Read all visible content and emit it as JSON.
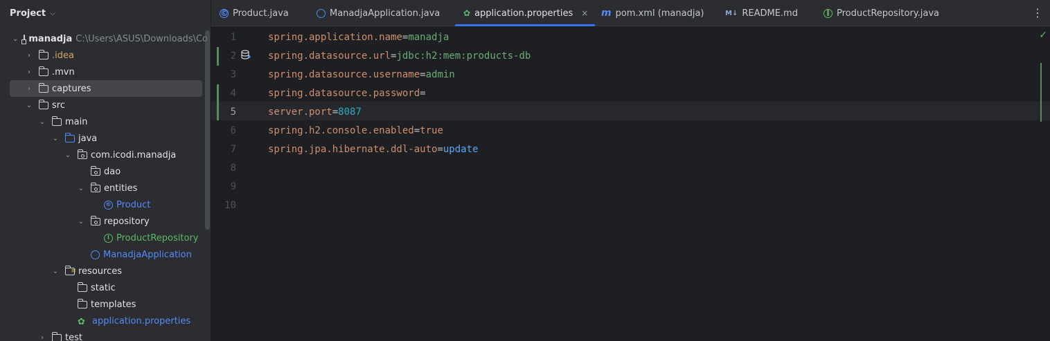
{
  "project_panel": {
    "title": "Project",
    "tree": [
      {
        "label": "manadja",
        "path": "C:\\Users\\ASUS\\Downloads\\Co"
      },
      {
        "label": ".idea"
      },
      {
        "label": ".mvn"
      },
      {
        "label": "captures"
      },
      {
        "label": "src"
      },
      {
        "label": "main"
      },
      {
        "label": "java"
      },
      {
        "label": "com.icodi.manadja"
      },
      {
        "label": "dao"
      },
      {
        "label": "entities"
      },
      {
        "label": "Product"
      },
      {
        "label": "repository"
      },
      {
        "label": "ProductRepository"
      },
      {
        "label": "ManadjaApplication"
      },
      {
        "label": "resources"
      },
      {
        "label": "static"
      },
      {
        "label": "templates"
      },
      {
        "label": "application.properties"
      },
      {
        "label": "test"
      }
    ]
  },
  "tabs": [
    {
      "label": "Product.java",
      "icon": "class-icon"
    },
    {
      "label": "ManadjaApplication.java",
      "icon": "spring-app-icon"
    },
    {
      "label": "application.properties",
      "icon": "spring-leaf-icon",
      "active": true
    },
    {
      "label": "pom.xml (manadja)",
      "icon": "maven-icon"
    },
    {
      "label": "README.md",
      "icon": "markdown-icon"
    },
    {
      "label": "ProductRepository.java",
      "icon": "interface-icon"
    }
  ],
  "tab_close_glyph": "×",
  "tab_icons": {
    "class": "©",
    "maven": "m",
    "markdown": "M↓",
    "interface": "I"
  },
  "editor": {
    "line_numbers": [
      "1",
      "2",
      "3",
      "4",
      "5",
      "6",
      "7",
      "8",
      "9",
      "10"
    ],
    "current_line": 5,
    "lines": [
      {
        "key": "spring.application.name",
        "eq": "=",
        "value": "manadja",
        "value_type": "string"
      },
      {
        "key": "spring.datasource.url",
        "eq": "=",
        "value": "jdbc:h2:mem:products-db",
        "value_type": "string"
      },
      {
        "key": "spring.datasource.username",
        "eq": "=",
        "value": "admin",
        "value_type": "string"
      },
      {
        "key": "spring.datasource.password",
        "eq": "=",
        "value": "",
        "value_type": "string"
      },
      {
        "key": "server.port",
        "eq": "=",
        "value": "8087",
        "value_type": "number"
      },
      {
        "key": "spring.h2.console.enabled",
        "eq": "=",
        "value": "true",
        "value_type": "keyword"
      },
      {
        "key": "spring.jpa.hibernate.ddl-auto",
        "eq": "=",
        "value": "update",
        "value_type": "enum"
      }
    ]
  },
  "colors": {
    "background": "#1e1f22",
    "panel": "#2b2d30",
    "key": "#cf8e6d",
    "string": "#6aab73",
    "number": "#2aacb8",
    "enum": "#56a8f5",
    "accent": "#3574f0",
    "check": "#5fb865"
  }
}
